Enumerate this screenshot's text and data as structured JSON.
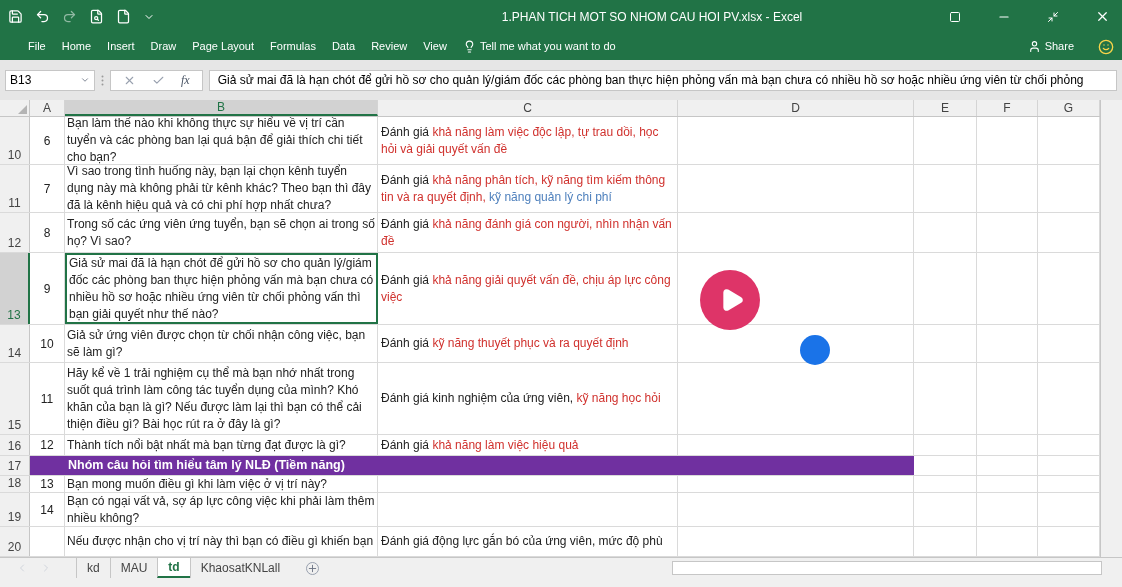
{
  "window": {
    "title": "1.PHAN TICH MOT SO NHOM CAU HOI PV.xlsx - Excel"
  },
  "ribbon_tabs": [
    {
      "label": "File",
      "selected": false
    },
    {
      "label": "Home",
      "selected": false
    },
    {
      "label": "Insert",
      "selected": false
    },
    {
      "label": "Draw",
      "selected": false
    },
    {
      "label": "Page Layout",
      "selected": false
    },
    {
      "label": "Formulas",
      "selected": false
    },
    {
      "label": "Data",
      "selected": false
    },
    {
      "label": "Review",
      "selected": false
    },
    {
      "label": "View",
      "selected": false
    }
  ],
  "tell_me": {
    "placeholder": "Tell me what you want to do"
  },
  "share": "Share",
  "formula_bar": {
    "name_box": "B13",
    "function_label": "fx",
    "value": "Giả sử mai đã là hạn chót để gửi hồ sơ cho quản lý/giám đốc các phòng ban thực hiện phỏng vấn mà bạn chưa có nhiều hồ sơ hoặc nhiều ứng viên từ chối phỏng"
  },
  "columns": [
    {
      "label": "A",
      "selected": false
    },
    {
      "label": "B",
      "selected": true
    },
    {
      "label": "C",
      "selected": false
    },
    {
      "label": "D",
      "selected": false
    },
    {
      "label": "E",
      "selected": false
    },
    {
      "label": "F",
      "selected": false
    },
    {
      "label": "G",
      "selected": false
    }
  ],
  "rows": [
    {
      "kind": "question",
      "number": "10",
      "selected": false,
      "a": "6",
      "b": "Bạn làm thế nào khi không thực sự hiểu về vị trí cần tuyển và các phòng ban lại quá bận để giải thích chi tiết cho bạn?",
      "c": [
        {
          "text": "Đánh giá ",
          "color": "#222222"
        },
        {
          "text": "khả năng làm việc độc lập, tự trau dồi, học hỏi và giải quyết vấn đề",
          "color": "#d0312d"
        }
      ]
    },
    {
      "kind": "question",
      "number": "11",
      "selected": false,
      "a": "7",
      "b": "Vì sao trong tình huống này, bạn lại chọn kênh tuyển dụng này mà không phải từ kênh khác? Theo bạn thì đây đã là kênh hiệu quả và có chi phí hợp nhất chưa?",
      "c": [
        {
          "text": "Đánh giá ",
          "color": "#222222"
        },
        {
          "text": "khả năng phân tích, kỹ năng tìm kiếm thông tin và ra quyết định, ",
          "color": "#d0312d"
        },
        {
          "text": "kỹ năng quản lý chi phí",
          "color": "#4f81bd"
        }
      ]
    },
    {
      "kind": "question",
      "number": "12",
      "selected": false,
      "a": "8",
      "b": "Trong số các ứng viên ứng tuyển, bạn sẽ chọn ai trong số họ? Vì sao?",
      "c": [
        {
          "text": "Đánh giá ",
          "color": "#222222"
        },
        {
          "text": "khả năng đánh giá con người, nhìn nhận vấn đề",
          "color": "#d0312d"
        }
      ]
    },
    {
      "kind": "question",
      "number": "13",
      "selected": true,
      "a": "9",
      "b": "Giả sử mai đã là hạn chót để gửi hồ sơ cho quản lý/giám đốc các phòng ban thực hiện phỏng vấn mà bạn chưa có nhiều hồ sơ hoặc nhiều ứng viên từ chối phỏng vấn thì bạn giải quyết như thế nào?",
      "c": [
        {
          "text": "Đánh giá ",
          "color": "#222222"
        },
        {
          "text": "khả năng giải quyết vấn đề, chịu áp lực công việc",
          "color": "#d0312d"
        }
      ]
    },
    {
      "kind": "question",
      "number": "14",
      "selected": false,
      "a": "10",
      "b": "Giả sử ứng viên được chọn từ chối nhận công việc, bạn sẽ làm gì?",
      "c": [
        {
          "text": "Đánh giá ",
          "color": "#222222"
        },
        {
          "text": "kỹ năng thuyết phục và ra quyết định",
          "color": "#d0312d"
        }
      ]
    },
    {
      "kind": "question",
      "number": "15",
      "selected": false,
      "a": "11",
      "b": "Hãy kể về 1 trải nghiệm cụ thể mà bạn nhớ nhất trong suốt quá trình làm công tác tuyển dụng của mình? Khó khăn của bạn là gì? Nếu được làm lại thì bạn có thể cải thiện điều gì? Bài học rút ra ở đây là gì?",
      "c": [
        {
          "text": "Đánh giá kinh nghiệm của ứng viên, ",
          "color": "#222222"
        },
        {
          "text": "kỹ năng học hỏi",
          "color": "#d0312d"
        }
      ]
    },
    {
      "kind": "question",
      "number": "16",
      "selected": false,
      "a": "12",
      "b": "Thành tích nổi bật nhất mà bạn từng đạt được là gì?",
      "c": [
        {
          "text": "Đánh giá ",
          "color": "#222222"
        },
        {
          "text": "khả năng làm việc hiệu quả",
          "color": "#d0312d"
        }
      ]
    },
    {
      "kind": "group",
      "number": "17",
      "selected": false,
      "b": "Nhóm câu hỏi tìm hiểu tâm lý NLĐ (Tiềm năng)"
    },
    {
      "kind": "question",
      "number": "18",
      "selected": false,
      "a": "13",
      "b": "Bạn mong muốn điều gì khi làm việc ở vị trí này?"
    },
    {
      "kind": "question",
      "number": "19",
      "selected": false,
      "a": "14",
      "b": "Bạn có ngại vất vả, sợ áp lực công việc khi phải làm thêm nhiều không?"
    },
    {
      "kind": "question",
      "number": "20",
      "selected": false,
      "b": "Nếu được nhận cho vị trí này thì bạn có điều gì khiến bạn",
      "c": [
        {
          "text": "Đánh giá động lực gắn bó của ứng viên, mức độ phù",
          "color": "#222222"
        }
      ]
    }
  ],
  "sheet_tabs": [
    {
      "label": "kd",
      "selected": false
    },
    {
      "label": "MAU",
      "selected": false
    },
    {
      "label": "td",
      "selected": true
    },
    {
      "label": "KhaosatKNLall",
      "selected": false
    }
  ]
}
